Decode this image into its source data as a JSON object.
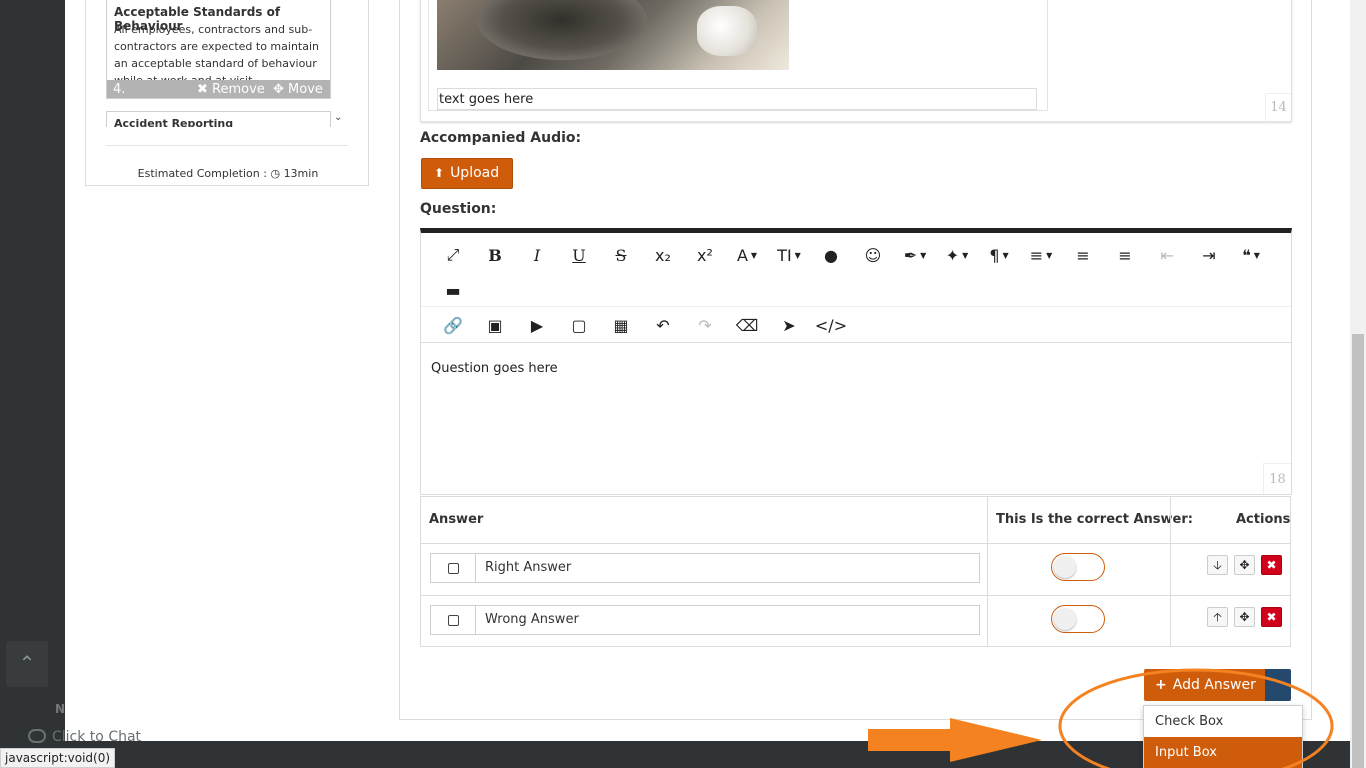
{
  "sidebar": {
    "lesson": {
      "title": "Acceptable Standards of Behaviour",
      "body": "All employees, contractors and sub-contractors are expected to maintain an acceptable standard of behaviour while at work and at visit",
      "number": "4.",
      "remove_label": "Remove",
      "move_label": "Move"
    },
    "next_lesson_title": "Accident Reporting",
    "estimated_label": "Estimated Completion :",
    "estimated_value": "13min"
  },
  "media": {
    "caption": "text goes here",
    "counter": "14"
  },
  "audio": {
    "label": "Accompanied Audio:",
    "upload_label": "Upload"
  },
  "question": {
    "label": "Question:",
    "body": "Question goes here",
    "counter": "18"
  },
  "toolbar": {
    "font_size_label": "TI"
  },
  "answers": {
    "col_answer": "Answer",
    "col_correct": "This Is the correct Answer:",
    "col_actions": "Actions",
    "rows": [
      {
        "text": "Right Answer",
        "correct": false
      },
      {
        "text": "Wrong Answer",
        "correct": false
      }
    ],
    "add_label": "Add Answer",
    "menu": [
      "Check Box",
      "Input Box"
    ]
  },
  "footer": {
    "chat_label": "Click to Chat",
    "status_url": "javascript:void(0)"
  },
  "colors": {
    "accent": "#cf5c0b",
    "secondary": "#24496d",
    "danger": "#d0021b",
    "annotation": "#f58220"
  }
}
